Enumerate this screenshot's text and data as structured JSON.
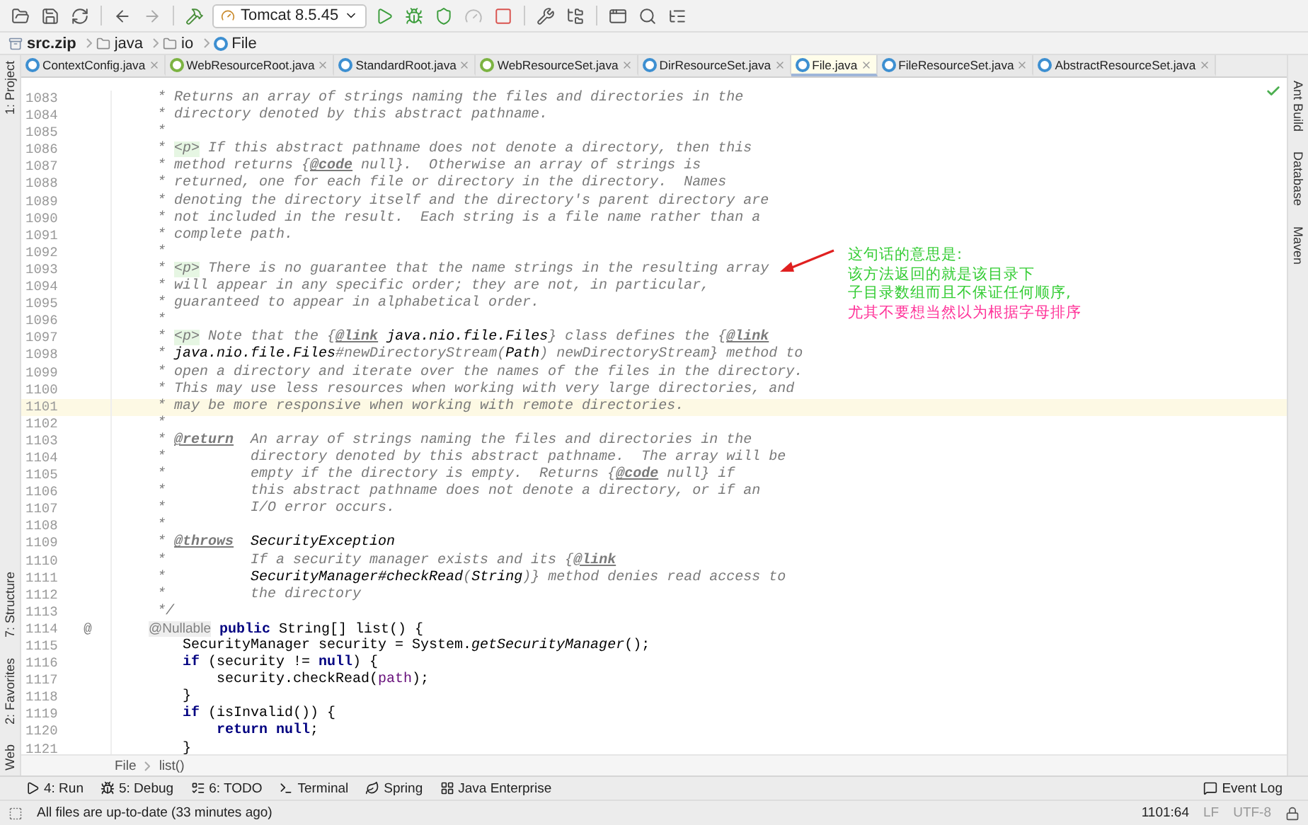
{
  "toolbar": {
    "run_config": "Tomcat 8.5.45"
  },
  "breadcrumb": [
    {
      "label": "src.zip",
      "kind": "archive"
    },
    {
      "label": "java",
      "kind": "folder"
    },
    {
      "label": "io",
      "kind": "folder"
    },
    {
      "label": "File",
      "kind": "class"
    }
  ],
  "tabs": [
    {
      "label": "ContextConfig.java",
      "kind": "class",
      "selected": false
    },
    {
      "label": "WebResourceRoot.java",
      "kind": "interface",
      "selected": false
    },
    {
      "label": "StandardRoot.java",
      "kind": "class",
      "selected": false
    },
    {
      "label": "WebResourceSet.java",
      "kind": "interface",
      "selected": false
    },
    {
      "label": "DirResourceSet.java",
      "kind": "class",
      "selected": false
    },
    {
      "label": "File.java",
      "kind": "class",
      "selected": true
    },
    {
      "label": "FileResourceSet.java",
      "kind": "class",
      "selected": false
    },
    {
      "label": "AbstractResourceSet.java",
      "kind": "class",
      "selected": false
    }
  ],
  "left_tool_windows": [
    {
      "label": "1: Project",
      "kind": "top"
    },
    {
      "label": "7: Structure",
      "kind": "bottom"
    },
    {
      "label": "2: Favorites",
      "kind": "bottom"
    },
    {
      "label": "Web",
      "kind": "bottom"
    }
  ],
  "right_tool_windows": [
    {
      "label": "Ant Build"
    },
    {
      "label": "Database"
    },
    {
      "label": "Maven"
    }
  ],
  "code_lines": [
    {
      "number": "1083",
      "current": false,
      "segments": [
        {
          "kind": "comment",
          "text": "     * Returns an array of strings naming the files and directories in the"
        }
      ]
    },
    {
      "number": "1084",
      "current": false,
      "segments": [
        {
          "kind": "comment",
          "text": "     * directory denoted by this abstract pathname."
        }
      ]
    },
    {
      "number": "1085",
      "current": false,
      "segments": [
        {
          "kind": "comment",
          "text": "     *"
        }
      ]
    },
    {
      "number": "1086",
      "current": false,
      "segments": [
        {
          "kind": "comment",
          "text": "     * "
        },
        {
          "kind": "html",
          "text": "<p>"
        },
        {
          "kind": "comment",
          "text": " If this abstract pathname does not denote a directory, then this"
        }
      ]
    },
    {
      "number": "1087",
      "current": false,
      "segments": [
        {
          "kind": "comment",
          "text": "     * method returns {"
        },
        {
          "kind": "doctag",
          "text": "@code"
        },
        {
          "kind": "comment",
          "text": " null}.  Otherwise an array of strings is"
        }
      ]
    },
    {
      "number": "1088",
      "current": false,
      "segments": [
        {
          "kind": "comment",
          "text": "     * returned, one for each file or directory in the directory.  Names"
        }
      ]
    },
    {
      "number": "1089",
      "current": false,
      "segments": [
        {
          "kind": "comment",
          "text": "     * denoting the directory itself and the directory's parent directory are"
        }
      ]
    },
    {
      "number": "1090",
      "current": false,
      "segments": [
        {
          "kind": "comment",
          "text": "     * not included in the result.  Each string is a file name rather than a"
        }
      ]
    },
    {
      "number": "1091",
      "current": false,
      "segments": [
        {
          "kind": "comment",
          "text": "     * complete path."
        }
      ]
    },
    {
      "number": "1092",
      "current": false,
      "segments": [
        {
          "kind": "comment",
          "text": "     *"
        }
      ]
    },
    {
      "number": "1093",
      "current": false,
      "segments": [
        {
          "kind": "comment",
          "text": "     * "
        },
        {
          "kind": "html",
          "text": "<p>"
        },
        {
          "kind": "comment",
          "text": " There is no guarantee that the name strings in the resulting array"
        }
      ]
    },
    {
      "number": "1094",
      "current": false,
      "segments": [
        {
          "kind": "comment",
          "text": "     * will appear in any specific order; they are not, in particular,"
        }
      ]
    },
    {
      "number": "1095",
      "current": false,
      "segments": [
        {
          "kind": "comment",
          "text": "     * guaranteed to appear in alphabetical order."
        }
      ]
    },
    {
      "number": "1096",
      "current": false,
      "segments": [
        {
          "kind": "comment",
          "text": "     *"
        }
      ]
    },
    {
      "number": "1097",
      "current": false,
      "segments": [
        {
          "kind": "comment",
          "text": "     * "
        },
        {
          "kind": "html",
          "text": "<p>"
        },
        {
          "kind": "comment",
          "text": " Note that the {"
        },
        {
          "kind": "doctag",
          "text": "@link"
        },
        {
          "kind": "ref",
          "text": " java.nio.file.Files"
        },
        {
          "kind": "comment",
          "text": "} class defines the {"
        },
        {
          "kind": "doctag",
          "text": "@link"
        }
      ]
    },
    {
      "number": "1098",
      "current": false,
      "segments": [
        {
          "kind": "comment",
          "text": "     * "
        },
        {
          "kind": "ref",
          "text": "java.nio.file.Files"
        },
        {
          "kind": "comment",
          "text": "#newDirectoryStream("
        },
        {
          "kind": "ref",
          "text": "Path"
        },
        {
          "kind": "comment",
          "text": ") newDirectoryStream} method to"
        }
      ]
    },
    {
      "number": "1099",
      "current": false,
      "segments": [
        {
          "kind": "comment",
          "text": "     * open a directory and iterate over the names of the files in the directory."
        }
      ]
    },
    {
      "number": "1100",
      "current": false,
      "segments": [
        {
          "kind": "comment",
          "text": "     * This may use less resources when working with very large directories, and"
        }
      ]
    },
    {
      "number": "1101",
      "current": true,
      "segments": [
        {
          "kind": "comment",
          "text": "     * may be more responsive when working with remote directories."
        }
      ]
    },
    {
      "number": "1102",
      "current": false,
      "segments": [
        {
          "kind": "comment",
          "text": "     *"
        }
      ]
    },
    {
      "number": "1103",
      "current": false,
      "segments": [
        {
          "kind": "comment",
          "text": "     * "
        },
        {
          "kind": "doctag",
          "text": "@return"
        },
        {
          "kind": "comment",
          "text": "  An array of strings naming the files and directories in the"
        }
      ]
    },
    {
      "number": "1104",
      "current": false,
      "segments": [
        {
          "kind": "comment",
          "text": "     *          directory denoted by this abstract pathname.  The array will be"
        }
      ]
    },
    {
      "number": "1105",
      "current": false,
      "segments": [
        {
          "kind": "comment",
          "text": "     *          empty if the directory is empty.  Returns {"
        },
        {
          "kind": "doctag",
          "text": "@code"
        },
        {
          "kind": "comment",
          "text": " null} if"
        }
      ]
    },
    {
      "number": "1106",
      "current": false,
      "segments": [
        {
          "kind": "comment",
          "text": "     *          this abstract pathname does not denote a directory, or if an"
        }
      ]
    },
    {
      "number": "1107",
      "current": false,
      "segments": [
        {
          "kind": "comment",
          "text": "     *          I/O error occurs."
        }
      ]
    },
    {
      "number": "1108",
      "current": false,
      "segments": [
        {
          "kind": "comment",
          "text": "     *"
        }
      ]
    },
    {
      "number": "1109",
      "current": false,
      "segments": [
        {
          "kind": "comment",
          "text": "     * "
        },
        {
          "kind": "doctag",
          "text": "@throws"
        },
        {
          "kind": "ref",
          "text": "  SecurityException"
        }
      ]
    },
    {
      "number": "1110",
      "current": false,
      "segments": [
        {
          "kind": "comment",
          "text": "     *          If a security manager exists and its {"
        },
        {
          "kind": "doctag",
          "text": "@link"
        }
      ]
    },
    {
      "number": "1111",
      "current": false,
      "segments": [
        {
          "kind": "comment",
          "text": "     *          "
        },
        {
          "kind": "ref",
          "text": "SecurityManager#checkRead"
        },
        {
          "kind": "comment",
          "text": "("
        },
        {
          "kind": "ref",
          "text": "String"
        },
        {
          "kind": "comment",
          "text": ")} method denies read access to"
        }
      ]
    },
    {
      "number": "1112",
      "current": false,
      "segments": [
        {
          "kind": "comment",
          "text": "     *          the directory"
        }
      ]
    },
    {
      "number": "1113",
      "current": false,
      "segments": [
        {
          "kind": "comment",
          "text": "     */"
        }
      ]
    },
    {
      "number": "1114",
      "current": false,
      "gutter_mark": "@",
      "segments": [
        {
          "kind": "annotation",
          "text": "    @Nullable"
        },
        {
          "kind": "keyword",
          "text": " public"
        },
        {
          "kind": "code",
          "text": " String[] list() {"
        }
      ]
    },
    {
      "number": "1115",
      "current": false,
      "segments": [
        {
          "kind": "code",
          "text": "        SecurityManager security = System."
        },
        {
          "kind": "static",
          "text": "getSecurityManager"
        },
        {
          "kind": "code",
          "text": "();"
        }
      ]
    },
    {
      "number": "1116",
      "current": false,
      "segments": [
        {
          "kind": "keyword",
          "text": "        if"
        },
        {
          "kind": "code",
          "text": " (security != "
        },
        {
          "kind": "keyword",
          "text": "null"
        },
        {
          "kind": "code",
          "text": ") {"
        }
      ]
    },
    {
      "number": "1117",
      "current": false,
      "segments": [
        {
          "kind": "code",
          "text": "            security.checkRead("
        },
        {
          "kind": "field",
          "text": "path"
        },
        {
          "kind": "code",
          "text": ");"
        }
      ]
    },
    {
      "number": "1118",
      "current": false,
      "segments": [
        {
          "kind": "code",
          "text": "        }"
        }
      ]
    },
    {
      "number": "1119",
      "current": false,
      "segments": [
        {
          "kind": "keyword",
          "text": "        if"
        },
        {
          "kind": "code",
          "text": " (isInvalid()) {"
        }
      ]
    },
    {
      "number": "1120",
      "current": false,
      "segments": [
        {
          "kind": "keyword",
          "text": "            return"
        },
        {
          "kind": "keyword",
          "text": " null"
        },
        {
          "kind": "code",
          "text": ";"
        }
      ]
    },
    {
      "number": "1121",
      "current": false,
      "segments": [
        {
          "kind": "code",
          "text": "        }"
        }
      ]
    }
  ],
  "annotation_note": {
    "lines": [
      {
        "text": "这句话的意思是:",
        "color": "#33cc33"
      },
      {
        "text": "该方法返回的就是该目录下",
        "color": "#33cc33"
      },
      {
        "text": "子目录数组而且不保证任何顺序,",
        "color": "#33cc33"
      },
      {
        "text": "尤其不要想当然以为根据字母排序",
        "color": "#ff3399"
      }
    ]
  },
  "editor_breadcrumb": [
    "File",
    "list()"
  ],
  "tool_window_bar": {
    "left": [
      {
        "label": "4: Run",
        "kind": "run"
      },
      {
        "label": "5: Debug",
        "kind": "debug"
      },
      {
        "label": "6: TODO",
        "kind": "todo"
      },
      {
        "label": "Terminal",
        "kind": "terminal"
      },
      {
        "label": "Spring",
        "kind": "spring"
      },
      {
        "label": "Java Enterprise",
        "kind": "enterprise"
      }
    ],
    "right": [
      {
        "label": "Event Log",
        "kind": "log"
      }
    ]
  },
  "status_bar": {
    "message": "All files are up-to-date (33 minutes ago)",
    "position": "1101:64",
    "line_separator": "LF",
    "encoding": "UTF-8"
  }
}
